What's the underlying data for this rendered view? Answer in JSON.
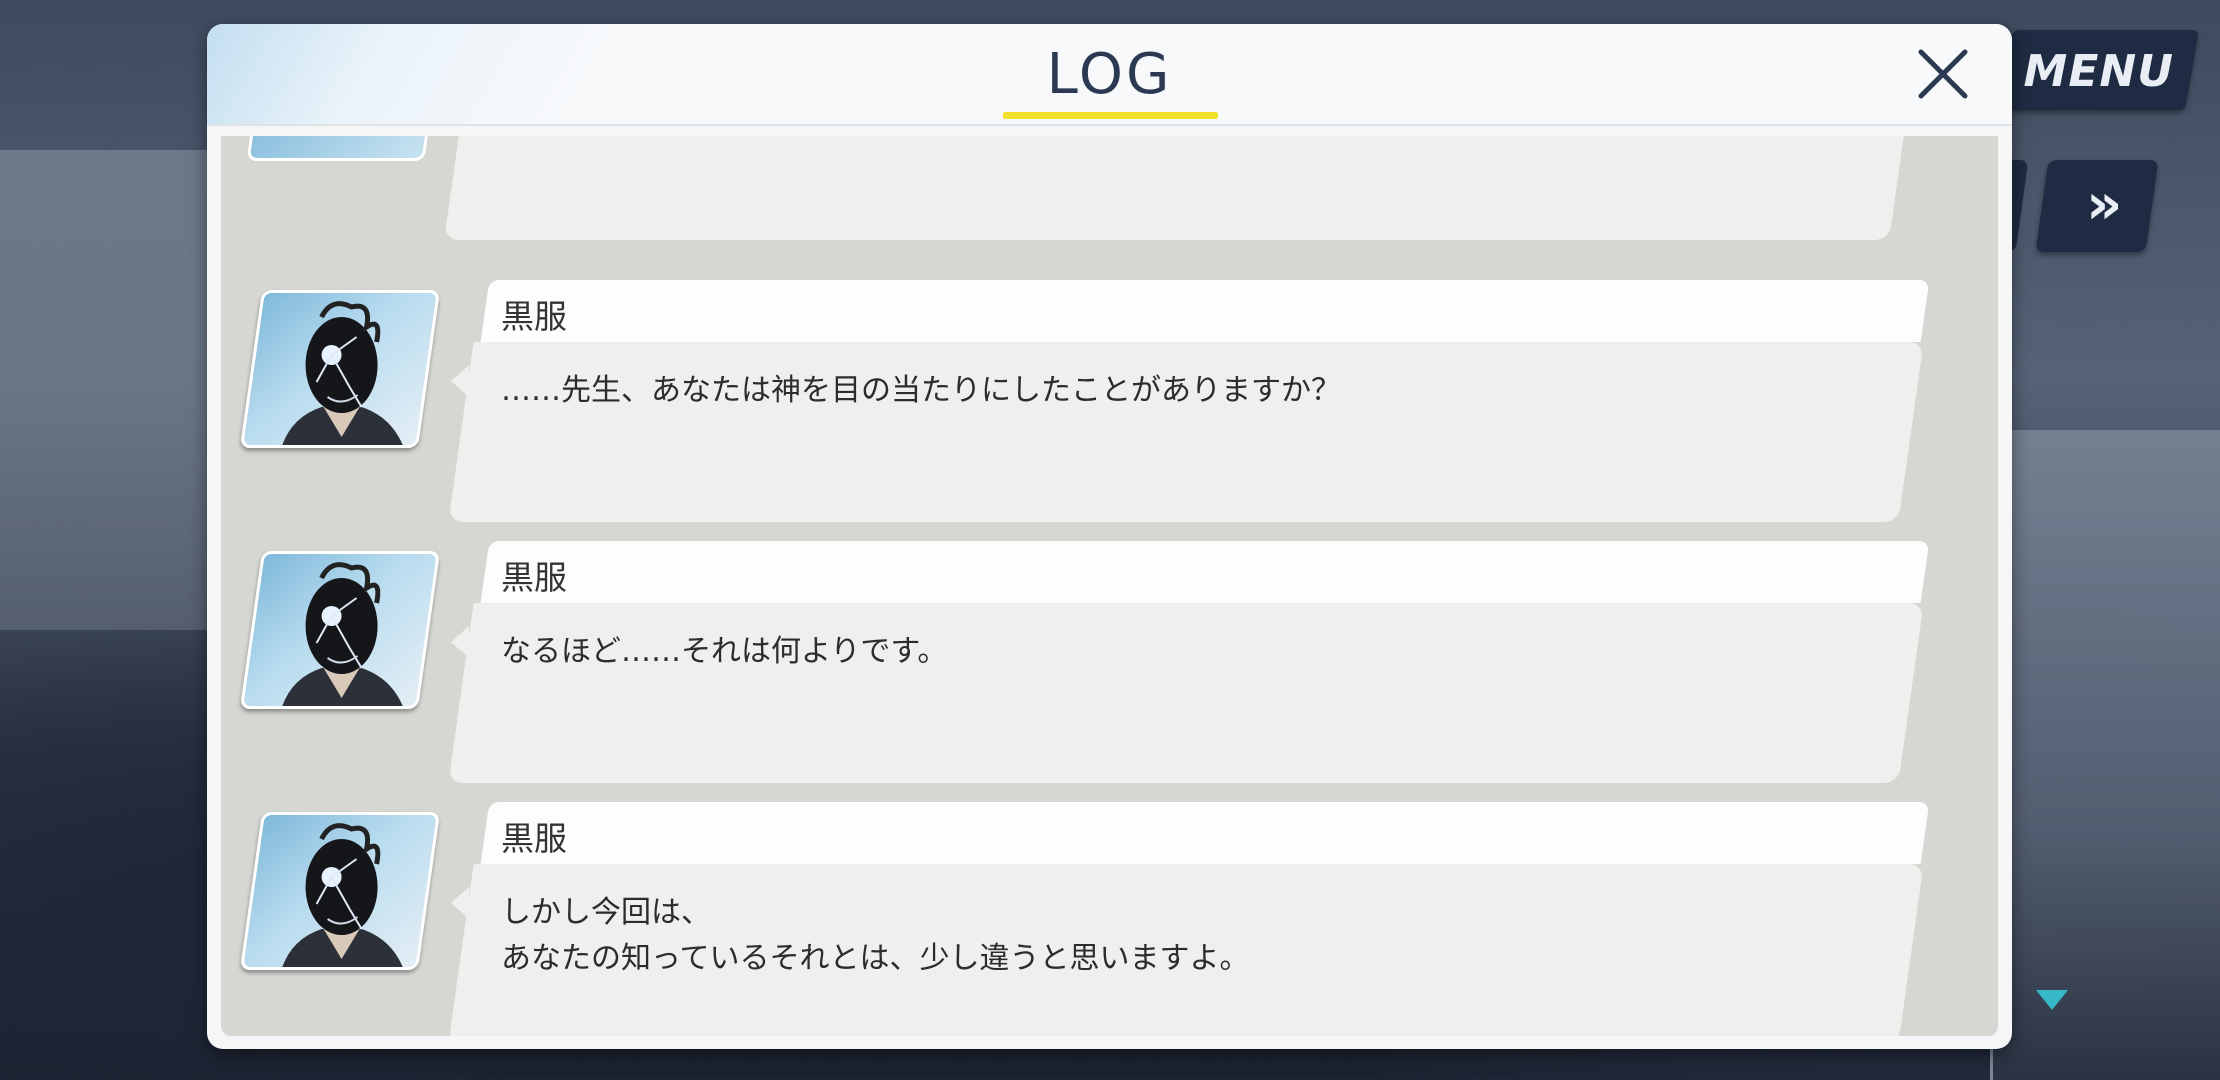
{
  "hud": {
    "menu_label": "MENU",
    "skip_label": "»"
  },
  "log": {
    "title": "LOG",
    "close_icon": "close-x-icon",
    "entries": [
      {
        "speaker": "黒服",
        "text": "……先生、あなたは神を目の当たりにしたことがありますか？"
      },
      {
        "speaker": "黒服",
        "text": "なるほど……それは何よりです。"
      },
      {
        "speaker": "黒服",
        "text": "しかし今回は、\nあなたの知っているそれとは、少し違うと思いますよ。"
      }
    ]
  },
  "colors": {
    "title_underline": "#f1e12c",
    "hud_button": "#1f2b42",
    "scroll_indicator": "#37b8c8"
  }
}
